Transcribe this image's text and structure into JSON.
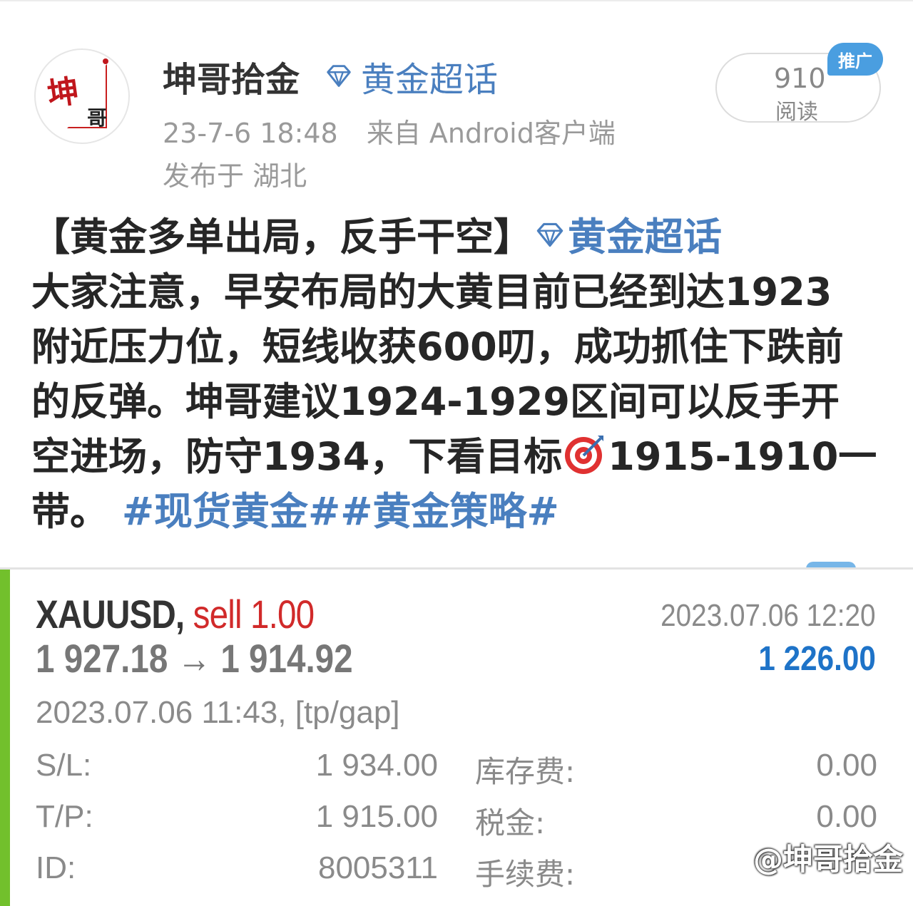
{
  "post": {
    "username": "坤哥拾金",
    "super_topic": "黄金超话",
    "timestamp": "23-7-6 18:48",
    "source": "来自 Android客户端",
    "location": "发布于 湖北",
    "reads": "910",
    "reads_label": "阅读",
    "promo_badge": "推广",
    "avatar_text_1": "坤",
    "avatar_text_2": "哥",
    "body": {
      "line1": "【黄金多单出局，反手干空】",
      "line1_link": "黄金超话",
      "line2": "大家注意，早安布局的大黄目前已经到达1923",
      "line3": "附近压力位，短线收获600叨，成功抓住下跌前",
      "line4": "的反弹。坤哥建议1924-1929区间可以反手开",
      "line5a": "空进场，防守1934，下看目标",
      "line5b": "1915-1910一",
      "line6": "带。",
      "hashtags": "#现货黄金##黄金策略#"
    }
  },
  "trade": {
    "symbol": "XAUUSD,",
    "side": "sell 1.00",
    "price_from": "1 927.18",
    "arrow": "→",
    "price_to": "1 914.92",
    "close_time": "2023.07.06 12:20",
    "profit": "1 226.00",
    "open_info": "2023.07.06 11:43, [tp/gap]",
    "rows": [
      {
        "k1": "S/L:",
        "v1": "1 934.00",
        "k2": "库存费:",
        "v2": "0.00"
      },
      {
        "k1": "T/P:",
        "v1": "1 915.00",
        "k2": "税金:",
        "v2": "0.00"
      },
      {
        "k1": "ID:",
        "v1": "8005311",
        "k2": "手续费:",
        "v2": ""
      }
    ]
  },
  "watermark": "@坤哥拾金",
  "colors": {
    "link": "#4a7fbf",
    "sell": "#d12a2a",
    "profit": "#1e73c8",
    "accent": "#72c02c",
    "promo": "#4a9ee0"
  },
  "icons": [
    "diamond-icon",
    "target-icon",
    "weibo-icon"
  ]
}
